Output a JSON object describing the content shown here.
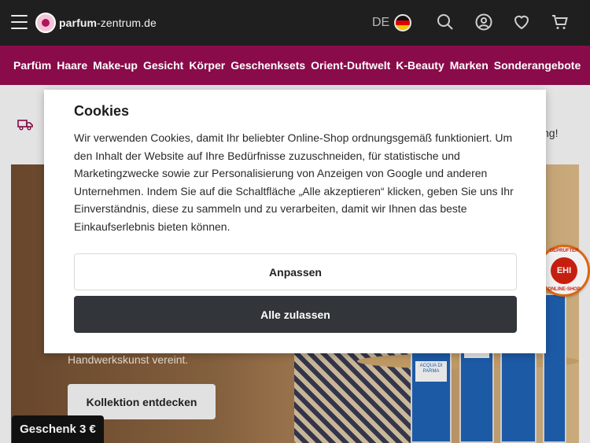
{
  "header": {
    "logo_bold": "parfum",
    "logo_rest": "-zentrum.de",
    "language": "DE",
    "icons": [
      "menu-icon",
      "search-icon",
      "account-icon",
      "heart-icon",
      "cart-icon"
    ]
  },
  "categories": [
    "Parfüm",
    "Haare",
    "Make-up",
    "Gesicht",
    "Körper",
    "Geschenksets",
    "Orient-Duftwelt",
    "K-Beauty",
    "Marken",
    "Sonderangebote"
  ],
  "shipping": {
    "text": "llung!"
  },
  "hero": {
    "subtitle": "Handwerkskunst vereint.",
    "button": "Kollektion entdecken",
    "bottle_labels": [
      "ACQUA DI PARMA",
      "ACQUA DI PARMA"
    ]
  },
  "badge": {
    "top": "GEPRÜFTER",
    "center": "EHI",
    "bottom": "ONLINE-SHOP"
  },
  "gift": {
    "label": "Geschenk 3 €"
  },
  "cookie_modal": {
    "title": "Cookies",
    "text": "Wir verwenden Cookies, damit Ihr beliebter Online-Shop ordnungsgemäß funktioniert. Um den Inhalt der Website auf Ihre Bedürfnisse zuzuschneiden, für statistische und Marketingzwecke sowie zur Personalisierung von Anzeigen von Google und anderen Unternehmen. Indem Sie auf die Schaltfläche „Alle akzeptieren“ klicken, geben Sie uns Ihr Einverständnis, diese zu sammeln und zu verarbeiten, damit wir Ihnen das beste Einkaufserlebnis bieten können.",
    "adjust_button": "Anpassen",
    "accept_button": "Alle zulassen"
  },
  "colors": {
    "header_bg": "#1f1f1f",
    "category_bg": "#8a0b4a",
    "accept_bg": "#32363a"
  }
}
